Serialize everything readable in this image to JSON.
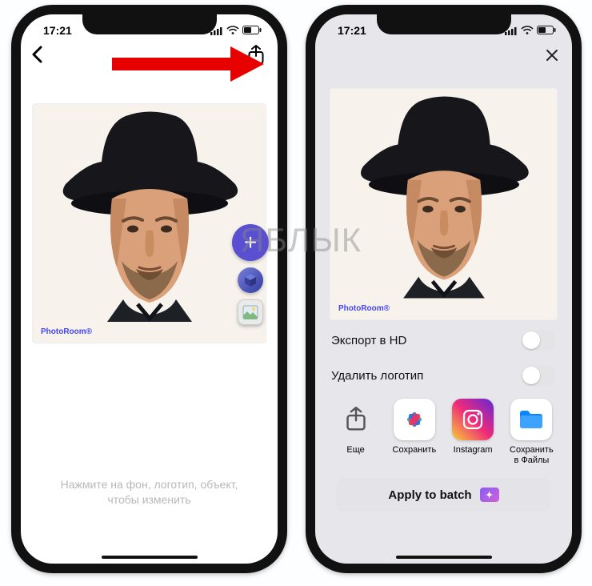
{
  "status": {
    "time": "17:21"
  },
  "left": {
    "watermark": "PhotoRoom®",
    "hint_line1": "Нажмите на фон, логотип, объект,",
    "hint_line2": "чтобы изменить"
  },
  "right": {
    "watermark": "PhotoRoom®",
    "options": {
      "hd": "Экспорт в HD",
      "remove_logo": "Удалить логотип"
    },
    "share": {
      "more": "Еще",
      "save": "Сохранить",
      "instagram": "Instagram",
      "files_l1": "Сохранить",
      "files_l2": "в Файлы"
    },
    "batch": "Apply to batch"
  },
  "overlay_watermark": "ЯБЛЫК"
}
